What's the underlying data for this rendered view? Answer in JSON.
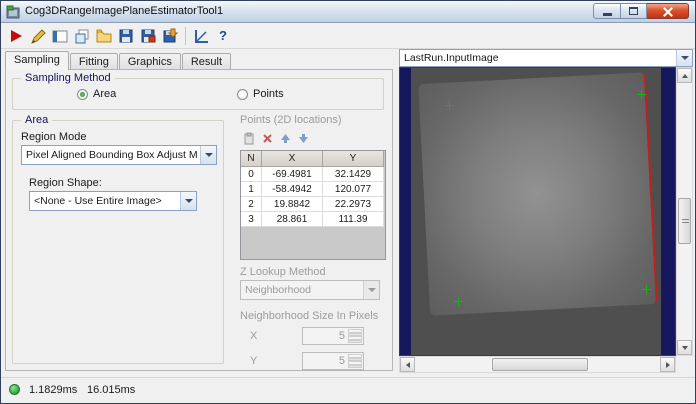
{
  "window": {
    "title": "Cog3DRangeImagePlaneEstimatorTool1"
  },
  "toolbar": {
    "icons": [
      "run",
      "edit",
      "electric",
      "tool-window",
      "open",
      "save",
      "save-result",
      "save-import",
      "measure",
      "help"
    ]
  },
  "tabs": {
    "items": [
      {
        "label": "Sampling"
      },
      {
        "label": "Fitting"
      },
      {
        "label": "Graphics"
      },
      {
        "label": "Result"
      }
    ],
    "active": "Sampling"
  },
  "sampling_method": {
    "title": "Sampling Method",
    "area_label": "Area",
    "points_label": "Points",
    "selected": "Area"
  },
  "area_group": {
    "title": "Area",
    "region_mode_label": "Region Mode",
    "region_mode_value": "Pixel Aligned Bounding Box Adjust Mask",
    "region_shape_label": "Region Shape:",
    "region_shape_value": "<None - Use Entire Image>"
  },
  "points_group": {
    "title": "Points (2D locations)",
    "columns": [
      "N",
      "X",
      "Y"
    ],
    "rows": [
      [
        "0",
        "-69.4981",
        "32.1429"
      ],
      [
        "1",
        "-58.4942",
        "120.077"
      ],
      [
        "2",
        "19.8842",
        "22.2973"
      ],
      [
        "3",
        "28.861",
        "111.39"
      ]
    ],
    "z_lookup_label": "Z Lookup Method",
    "z_lookup_value": "Neighborhood",
    "neighborhood_label": "Neighborhood Size In Pixels",
    "x_label": "X",
    "x_value": "5",
    "y_label": "Y",
    "y_value": "5"
  },
  "image_panel": {
    "selected_image": "LastRun.InputImage"
  },
  "status": {
    "time1": "1.1829ms",
    "time2": "16.015ms"
  }
}
